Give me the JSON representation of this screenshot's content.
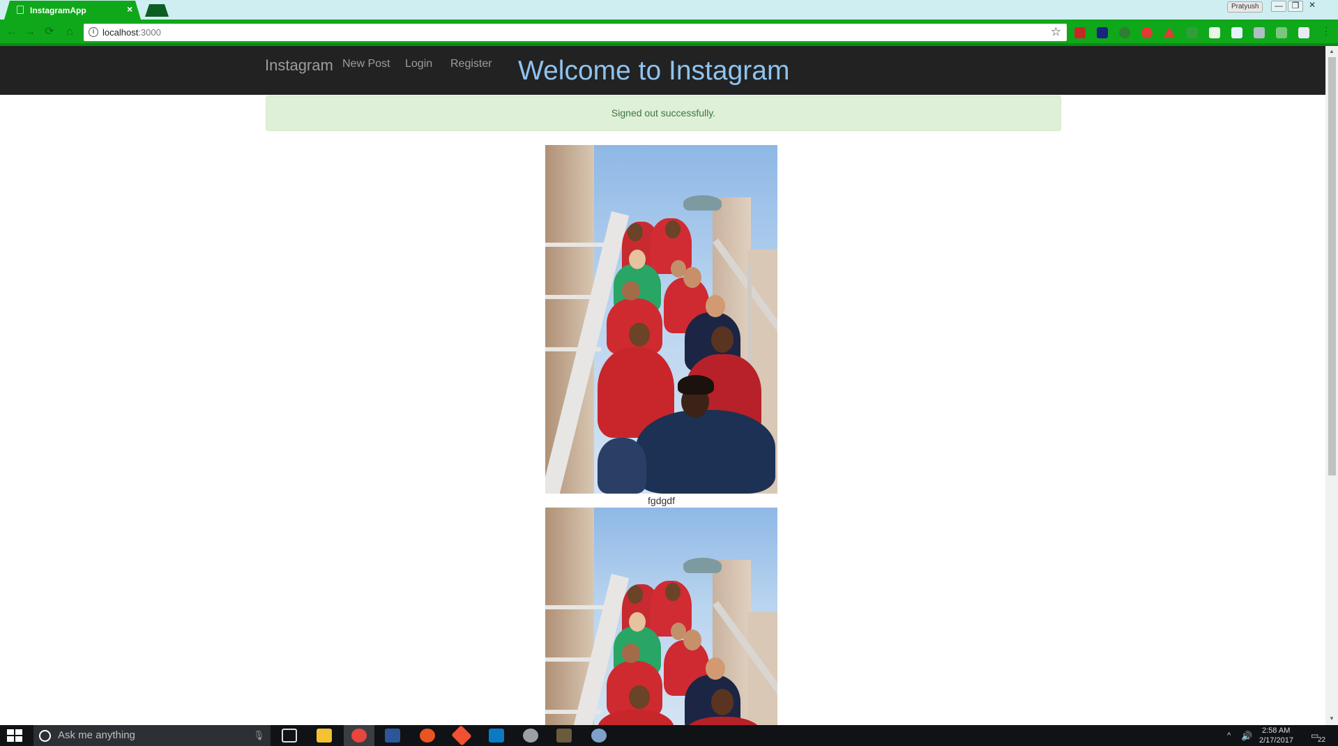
{
  "browser": {
    "tab_title": "InstagramApp",
    "tab_close": "×",
    "profile_name": "Pratyush",
    "url_host": "localhost",
    "url_port": ":3000",
    "window_controls": [
      "—",
      "❐",
      "✕"
    ]
  },
  "navbar": {
    "brand": "Instagram",
    "links": [
      "New Post",
      "Login",
      "Register"
    ],
    "heading": "Welcome to Instagram"
  },
  "alert": {
    "message": "Signed out successfully."
  },
  "posts": [
    {
      "caption": "fgdgdf"
    },
    {
      "caption": ""
    }
  ],
  "taskbar": {
    "search_placeholder": "Ask me anything",
    "clock_time": "2:58 AM",
    "clock_date": "2/17/2017",
    "notification_count": "22"
  },
  "colors": {
    "browser_green": "#0fa81a",
    "navbar_bg": "#222222",
    "welcome_blue": "#8fc3ef",
    "alert_bg": "#dff0d8",
    "alert_text": "#3c763d"
  }
}
